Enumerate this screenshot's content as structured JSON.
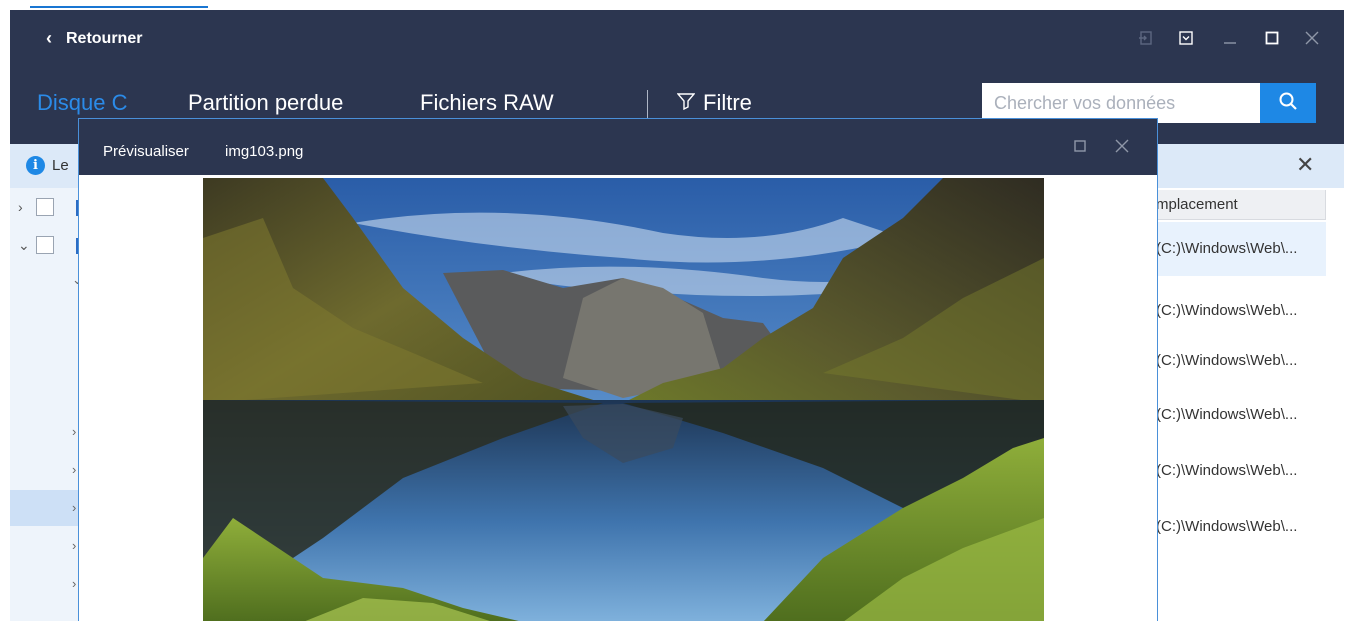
{
  "window": {
    "back_label": "Retourner"
  },
  "nav": {
    "tabs": [
      {
        "label": "Disque C",
        "active": true
      },
      {
        "label": "Partition perdue",
        "active": false
      },
      {
        "label": "Fichiers RAW",
        "active": false
      }
    ],
    "filter_label": "Filtre"
  },
  "search": {
    "placeholder": "Chercher vos données"
  },
  "info_bar": {
    "text": "Le"
  },
  "file_table": {
    "location_header": "mplacement",
    "location_values": [
      "(C:)\\Windows\\Web\\...",
      "(C:)\\Windows\\Web\\...",
      "(C:)\\Windows\\Web\\...",
      "(C:)\\Windows\\Web\\...",
      "(C:)\\Windows\\Web\\...",
      "(C:)\\Windows\\Web\\..."
    ]
  },
  "preview": {
    "title_label": "Prévisualiser",
    "file_name": "img103.png"
  },
  "colors": {
    "titlebar": "#2c3650",
    "accent": "#1e88e5",
    "active_tab": "#2b8be8",
    "info_bg": "#dce9f8"
  }
}
